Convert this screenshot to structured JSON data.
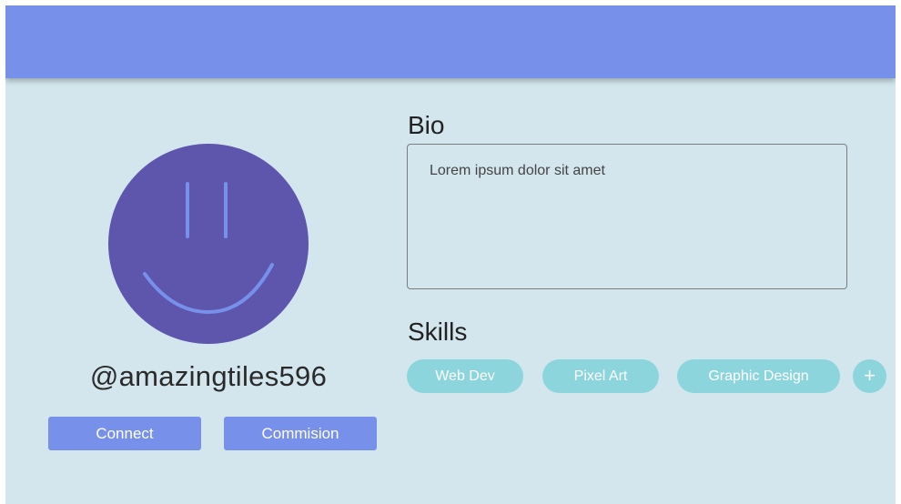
{
  "colors": {
    "header": "#7790ea",
    "background": "#d3e6ee",
    "avatar_fill": "#5e55ad",
    "avatar_face": "#7790ea",
    "button": "#7790ea",
    "chip": "#8cd5dd"
  },
  "profile": {
    "username": "@amazingtiles596",
    "avatar_icon": "smiley-face-icon"
  },
  "actions": {
    "connect_label": "Connect",
    "commission_label": "Commision"
  },
  "bio": {
    "title": "Bio",
    "text": "Lorem ipsum dolor sit amet"
  },
  "skills": {
    "title": "Skills",
    "items": [
      "Web Dev",
      "Pixel Art",
      "Graphic Design"
    ],
    "add_label": "+"
  }
}
